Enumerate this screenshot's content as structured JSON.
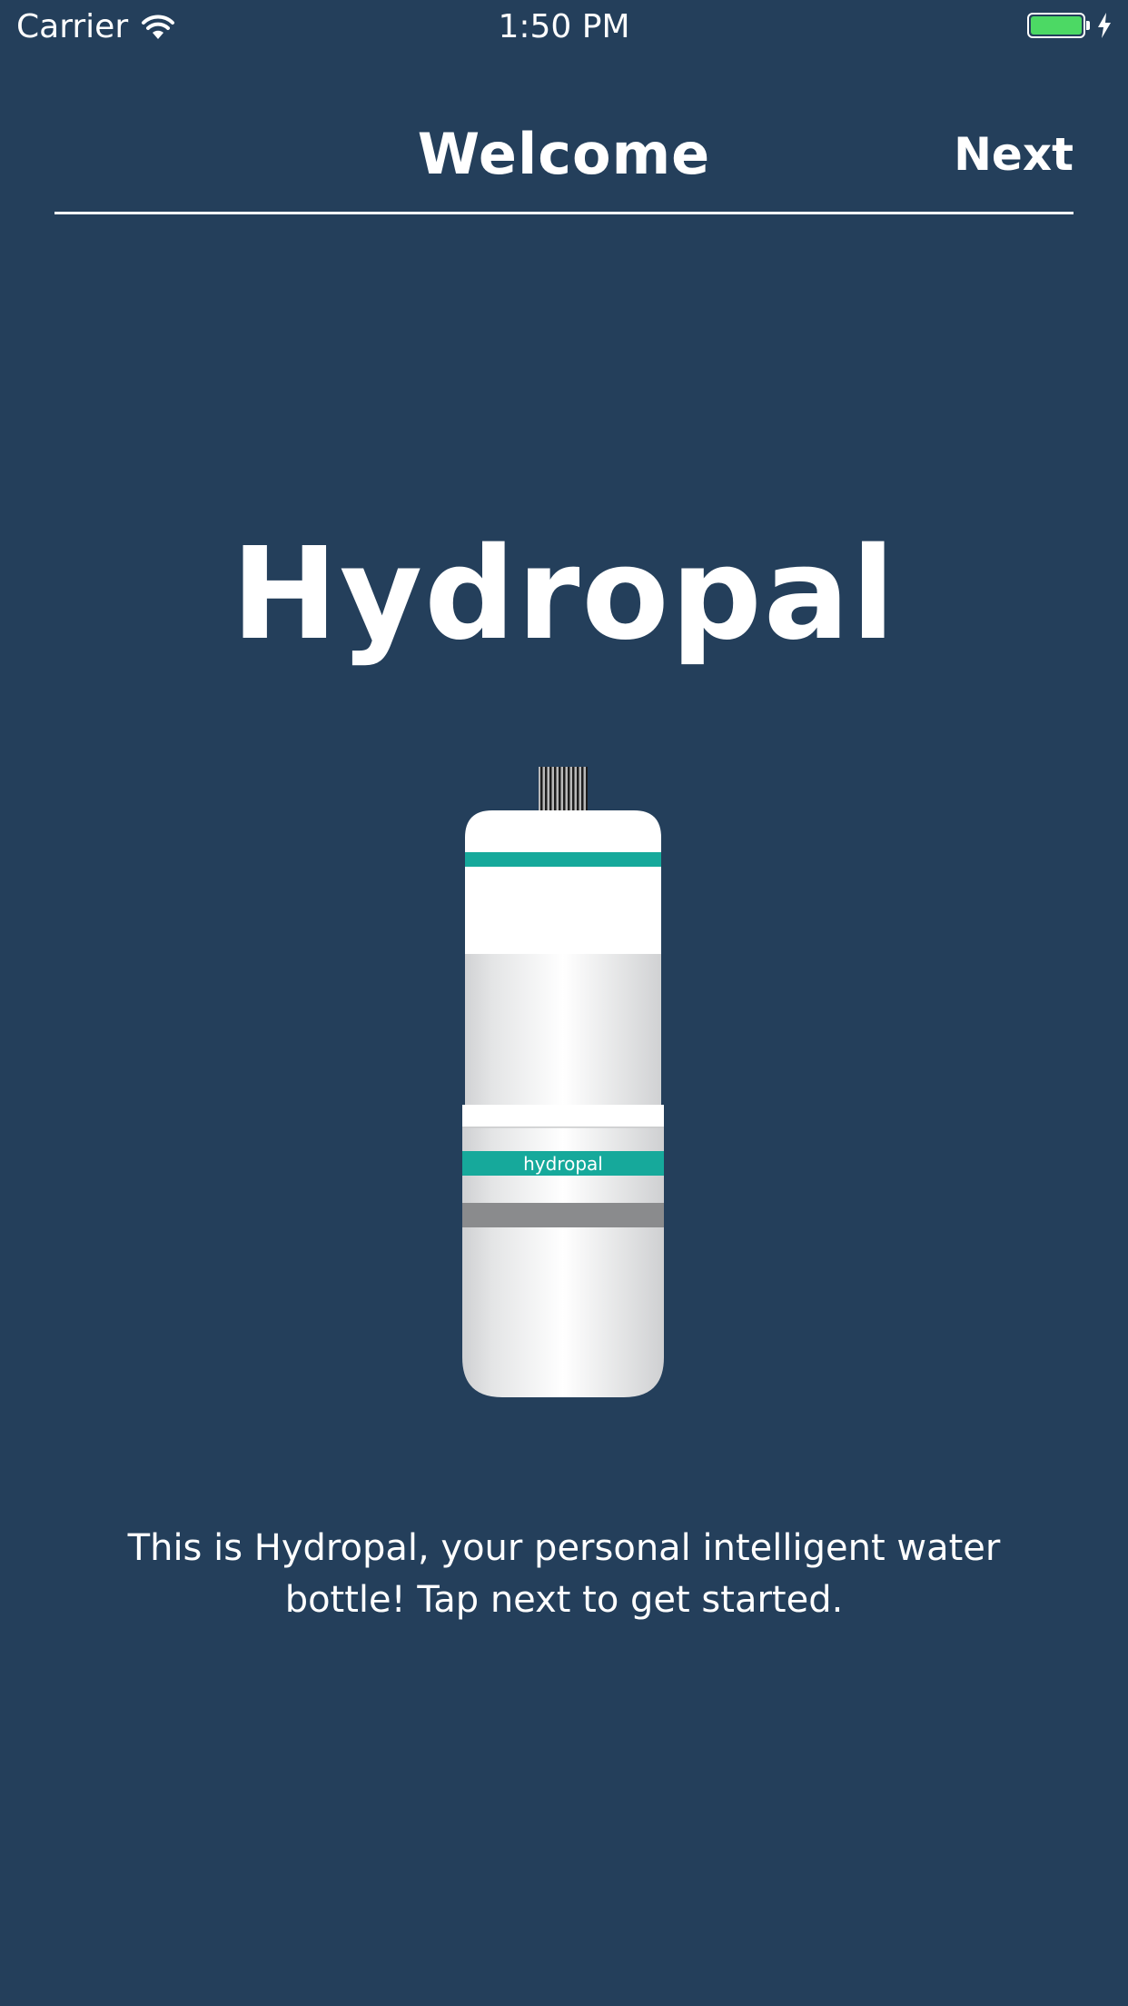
{
  "status_bar": {
    "carrier": "Carrier",
    "time": "1:50 PM",
    "battery_color": "#4cd964"
  },
  "nav": {
    "title": "Welcome",
    "next_label": "Next"
  },
  "main": {
    "app_name": "Hydropal",
    "bottle_label": "hydropal",
    "description": "This is Hydropal, your personal intelligent water bottle! Tap next to get started."
  },
  "colors": {
    "background": "#243f5b",
    "accent_teal": "#16a99b",
    "text": "#ffffff"
  },
  "icons": [
    "wifi-icon",
    "battery-icon",
    "charging-bolt-icon",
    "water-bottle-illustration"
  ]
}
